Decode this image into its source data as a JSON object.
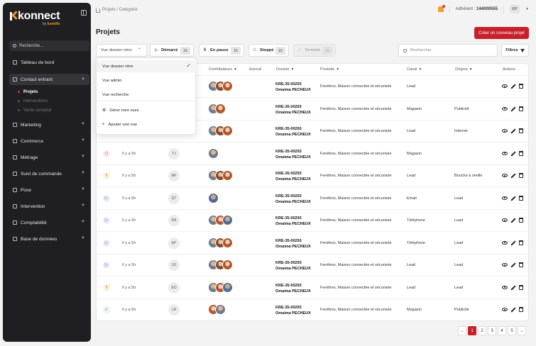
{
  "sidebar": {
    "logo": "konnect",
    "logo_by": "by",
    "logo_brand": "komilfo",
    "search_placeholder": "Recherche...",
    "items": [
      {
        "label": "Tableau de bord",
        "name": "tableau-de-bord"
      },
      {
        "label": "Contact entrant",
        "name": "contact-entrant"
      },
      {
        "label": "Marketing",
        "name": "marketing"
      },
      {
        "label": "Commerce",
        "name": "commerce"
      },
      {
        "label": "Métrage",
        "name": "metrage"
      },
      {
        "label": "Suivi de commande",
        "name": "suivi-de-commande"
      },
      {
        "label": "Pose",
        "name": "pose"
      },
      {
        "label": "Intervention",
        "name": "intervention"
      },
      {
        "label": "Comptabilité",
        "name": "comptabilite"
      },
      {
        "label": "Base de données",
        "name": "base-de-donnees"
      }
    ],
    "subitems": [
      {
        "label": "Projets"
      },
      {
        "label": "Interventions"
      },
      {
        "label": "Vente comptoir"
      }
    ]
  },
  "topbar": {
    "breadcrumb_parent": "Projets",
    "breadcrumb_sep": "/",
    "breadcrumb_current": "Catégorie",
    "adherent_label": "Adhérent :",
    "adherent_value": "144000555",
    "user_initials": "EP"
  },
  "page": {
    "title": "Projets",
    "create_button": "Créer un nouveau projet"
  },
  "filters": {
    "view_select": "Vue dossier réno",
    "statuses": [
      {
        "label": "Démarré",
        "count": "15",
        "icon": "▷"
      },
      {
        "label": "En pause",
        "count": "15",
        "icon": "‖"
      },
      {
        "label": "Stoppé",
        "count": "15",
        "icon": "□"
      },
      {
        "label": "Terminé",
        "count": "15",
        "icon": "✓"
      }
    ],
    "search_placeholder": "Rechercher",
    "filters_button": "Filtres"
  },
  "dropdown": {
    "items": [
      {
        "label": "Vue dossier réno"
      },
      {
        "label": "Vue admin"
      },
      {
        "label": "Vue recherche"
      },
      {
        "label": "Gérer mes vues",
        "icon": "⚙"
      },
      {
        "label": "Ajouter une vue",
        "icon": "+"
      }
    ],
    "check": "✓"
  },
  "table": {
    "headers": {
      "contributeurs": "Contributeurs",
      "journal": "Journal",
      "dossier": "Dossier",
      "produits": "Produits",
      "canal": "Canal",
      "origine": "Origine",
      "actions": "Actions"
    },
    "rows": [
      {
        "status": "",
        "time": "",
        "initials": "",
        "avatars": [
          "av1",
          "av2",
          "av3"
        ],
        "code": "KRE-35-00293",
        "owner": "Omaima PECHEUX",
        "produits": "Fenêtres, Maison connectée et sécurisée",
        "canal": "Lead",
        "origine": ""
      },
      {
        "status": "",
        "time": "",
        "initials": "",
        "avatars": [
          "av1",
          "av3"
        ],
        "code": "KRE-35-00293",
        "owner": "Omaima PECHEUX",
        "produits": "Fenêtres, Maison connectée et sécurisée",
        "canal": "Magasin",
        "origine": "Publicité"
      },
      {
        "status": "",
        "time": "",
        "initials": "",
        "avatars": [
          "av1",
          "av2",
          "av3"
        ],
        "code": "KRE-35-00293",
        "owner": "Omaima PECHEUX",
        "produits": "Fenêtres, Maison connectée et sécurisée",
        "canal": "Lead",
        "origine": "Internet"
      },
      {
        "status": "stop",
        "time": "Il y a 5h",
        "initials": "TJ",
        "avatars": [
          "av1"
        ],
        "code": "KRE-35-00293",
        "owner": "Omaima PECHEUX",
        "produits": "Fenêtres, Maison connectée et sécurisée",
        "canal": "Magasin",
        "origine": ""
      },
      {
        "status": "pause",
        "time": "Il y a 5h",
        "initials": "MF",
        "avatars": [
          "av1",
          "av2",
          "av3"
        ],
        "code": "KRE-35-00293",
        "owner": "Omaima PECHEUX",
        "produits": "Fenêtres, Maison connectée et sécurisée",
        "canal": "Lead",
        "origine": "Bouche à oreille"
      },
      {
        "status": "play",
        "time": "Il y a 5h",
        "initials": "GT",
        "avatars": [
          "av4"
        ],
        "code": "KRE-35-00293",
        "owner": "Omaima PECHEUX",
        "produits": "Fenêtres, Maison connectée et sécurisée",
        "canal": "Email",
        "origine": "Lead"
      },
      {
        "status": "play",
        "time": "Il y a 5h",
        "initials": "RA",
        "avatars": [
          "av1",
          "av3",
          "av4"
        ],
        "code": "KRE-35-00293",
        "owner": "Omaima PECHEUX",
        "produits": "Fenêtres, Maison connectée et sécurisée",
        "canal": "Téléphone",
        "origine": "Lead"
      },
      {
        "status": "play",
        "time": "Il y a 5h",
        "initials": "EP",
        "avatars": [
          "av1",
          "av2",
          "av3"
        ],
        "code": "KRE-35-00293",
        "owner": "Omaima PECHEUX",
        "produits": "Fenêtres, Maison connectée et sécurisée",
        "canal": "Téléphone",
        "origine": "Lead"
      },
      {
        "status": "play",
        "time": "Il y a 5h",
        "initials": "US",
        "avatars": [
          "av1",
          "av2",
          "av3"
        ],
        "code": "KRE-35-00293",
        "owner": "Omaima PECHEUX",
        "produits": "Fenêtres, Maison connectée et sécurisée",
        "canal": "Lead",
        "origine": "Lead"
      },
      {
        "status": "pause",
        "time": "Il y a 5h",
        "initials": "EO",
        "avatars": [
          "av1",
          "av3",
          "av4"
        ],
        "code": "KRE-35-00293",
        "owner": "Omaima PECHEUX",
        "produits": "Fenêtres, Maison connectée et sécurisée",
        "canal": "Lead",
        "origine": "Lead"
      },
      {
        "status": "done",
        "time": "Il y a 5h",
        "initials": "LR",
        "avatars": [
          "av3",
          "av1"
        ],
        "code": "KRE-35-00293",
        "owner": "Omaima PECHEUX",
        "produits": "Fenêtres, Maison connectée et sécurisée",
        "canal": "Magasin",
        "origine": "Publicité"
      }
    ]
  },
  "pagination": {
    "prev": "←",
    "pages": [
      "1",
      "2",
      "3",
      "4",
      "5"
    ],
    "next": "→",
    "active": "1"
  },
  "colors": {
    "accent": "#c7202a",
    "sidebar_bg": "#1f1f22",
    "logo_orange": "#e8952a"
  }
}
